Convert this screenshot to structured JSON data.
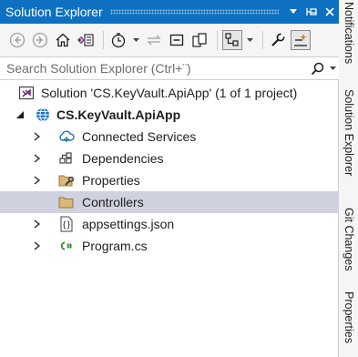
{
  "window": {
    "title": "Solution Explorer",
    "buttons": {
      "dropdown": "▾",
      "pin": "⊣",
      "close": "✕"
    }
  },
  "toolbar": {
    "icons": [
      "back-icon",
      "forward-icon",
      "home-icon",
      "switch-views-icon",
      "pending-changes-icon",
      "sync-icon",
      "collapse-all-icon",
      "show-all-files-icon",
      "preview-selected-icon",
      "properties-icon",
      "toggle-view-icon"
    ]
  },
  "search": {
    "placeholder": "Search Solution Explorer (Ctrl+¨)"
  },
  "tree": {
    "solution": "Solution 'CS.KeyVault.ApiApp' (1 of 1 project)",
    "project": "CS.KeyVault.ApiApp",
    "items": [
      {
        "label": "Connected Services",
        "icon": "cloud-icon"
      },
      {
        "label": "Dependencies",
        "icon": "dependencies-icon"
      },
      {
        "label": "Properties",
        "icon": "wrench-folder-icon"
      },
      {
        "label": "Controllers",
        "icon": "folder-icon",
        "selected": true
      },
      {
        "label": "appsettings.json",
        "icon": "json-icon"
      },
      {
        "label": "Program.cs",
        "icon": "csharp-icon"
      }
    ]
  },
  "dock": {
    "tabs": [
      "Notifications",
      "Solution Explorer",
      "Git Changes",
      "Properties"
    ]
  },
  "colors": {
    "title_bar": "#0e70c0",
    "selection": "#cfd1de",
    "vs_purple": "#68217a"
  }
}
